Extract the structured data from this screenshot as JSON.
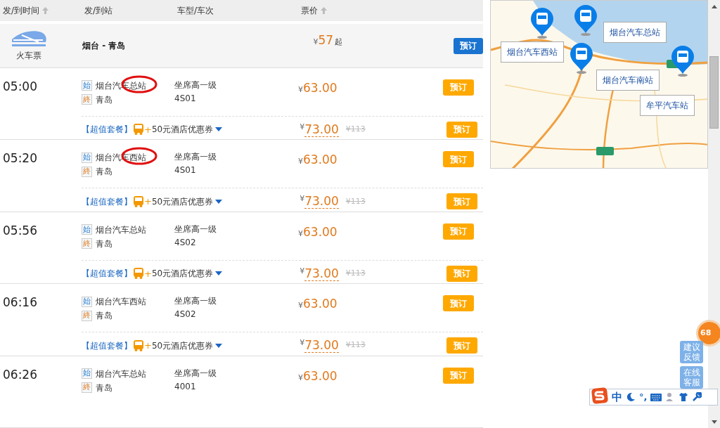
{
  "header": {
    "columns": [
      {
        "label": "发/到时间",
        "sortable": true
      },
      {
        "label": "发/到站",
        "sortable": false
      },
      {
        "label": "车型/车次",
        "sortable": false
      },
      {
        "label": "票价",
        "sortable": true
      }
    ]
  },
  "summary": {
    "label": "火车票",
    "route": "烟台 - 青岛",
    "currency": "¥",
    "price": "57",
    "suffix": "起",
    "button": "预订"
  },
  "trips": [
    {
      "time": "05:00",
      "from_badge": "始",
      "from": "烟台汽车总站",
      "circled": true,
      "to_badge": "終",
      "to": "青岛",
      "seat": "坐席高一级",
      "train": "4S01",
      "currency": "¥",
      "price": "63.00",
      "button": "预订",
      "package": {
        "tag": "【超值套餐】",
        "plus": "+",
        "offer": "50元酒店优惠券",
        "currency": "¥",
        "price": "73.00",
        "original": "¥113",
        "button": "预订"
      }
    },
    {
      "time": "05:20",
      "from_badge": "始",
      "from": "烟台汽车西站",
      "circled": true,
      "to_badge": "終",
      "to": "青岛",
      "seat": "坐席高一级",
      "train": "4S01",
      "currency": "¥",
      "price": "63.00",
      "button": "预订",
      "package": {
        "tag": "【超值套餐】",
        "plus": "+",
        "offer": "50元酒店优惠券",
        "currency": "¥",
        "price": "73.00",
        "original": "¥113",
        "button": "预订"
      }
    },
    {
      "time": "05:56",
      "from_badge": "始",
      "from": "烟台汽车总站",
      "circled": false,
      "to_badge": "終",
      "to": "青岛",
      "seat": "坐席高一级",
      "train": "4S02",
      "currency": "¥",
      "price": "63.00",
      "button": "预订",
      "package": {
        "tag": "【超值套餐】",
        "plus": "+",
        "offer": "50元酒店优惠券",
        "currency": "¥",
        "price": "73.00",
        "original": "¥113",
        "button": "预订"
      }
    },
    {
      "time": "06:16",
      "from_badge": "始",
      "from": "烟台汽车西站",
      "circled": false,
      "to_badge": "終",
      "to": "青岛",
      "seat": "坐席高一级",
      "train": "4S02",
      "currency": "¥",
      "price": "63.00",
      "button": "预订",
      "package": {
        "tag": "【超值套餐】",
        "plus": "+",
        "offer": "50元酒店优惠券",
        "currency": "¥",
        "price": "73.00",
        "original": "¥113",
        "button": "预订"
      }
    },
    {
      "time": "06:26",
      "from_badge": "始",
      "from": "烟台汽车总站",
      "circled": false,
      "to_badge": "終",
      "to": "青岛",
      "seat": "坐席高一级",
      "train": "4001",
      "currency": "¥",
      "price": "63.00",
      "button": "预订"
    }
  ],
  "map": {
    "stations": [
      {
        "label": "烟台汽车西站"
      },
      {
        "label": "烟台汽车总站"
      },
      {
        "label": "烟台汽车南站"
      },
      {
        "label": "牟平汽车站"
      }
    ]
  },
  "side_buttons": [
    {
      "label": "建议反馈"
    },
    {
      "label": "在线客服"
    }
  ],
  "badge": "68",
  "ime_toolbar": {
    "mode": "中",
    "punct": "°,"
  }
}
